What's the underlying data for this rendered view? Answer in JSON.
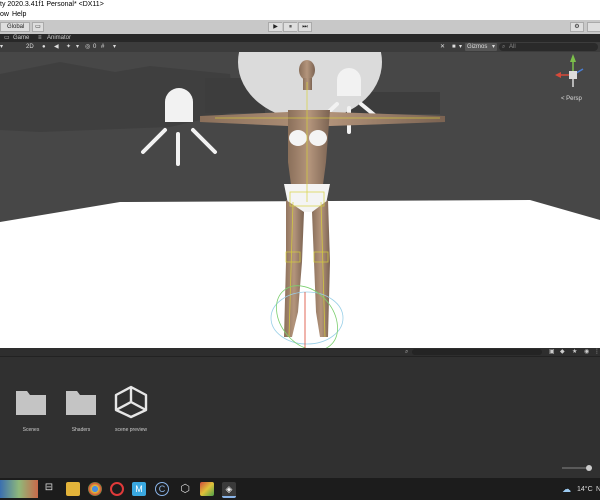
{
  "window": {
    "title": "ty 2020.3.41f1 Personal* <DX11>"
  },
  "menu": {
    "items": [
      "ow",
      "Help"
    ]
  },
  "toolbar": {
    "global_label": "Global",
    "play": "▶",
    "pause": "⏸",
    "step": "⏭"
  },
  "tabs": {
    "game": "Game",
    "animator": "Animator"
  },
  "scene_toolbar": {
    "mode_2d": "2D",
    "gizmos": "Gizmos",
    "search_placeholder": "All",
    "count": "0"
  },
  "viewport": {
    "persp_label": "< Persp"
  },
  "project": {
    "assets": [
      {
        "name": "Scenes",
        "icon": "folder-icon"
      },
      {
        "name": "Shaders",
        "icon": "folder-icon"
      },
      {
        "name": "scene preview",
        "icon": "unity-logo-icon"
      }
    ]
  },
  "taskbar": {
    "temperature": "14°C",
    "tray_text": "N"
  }
}
